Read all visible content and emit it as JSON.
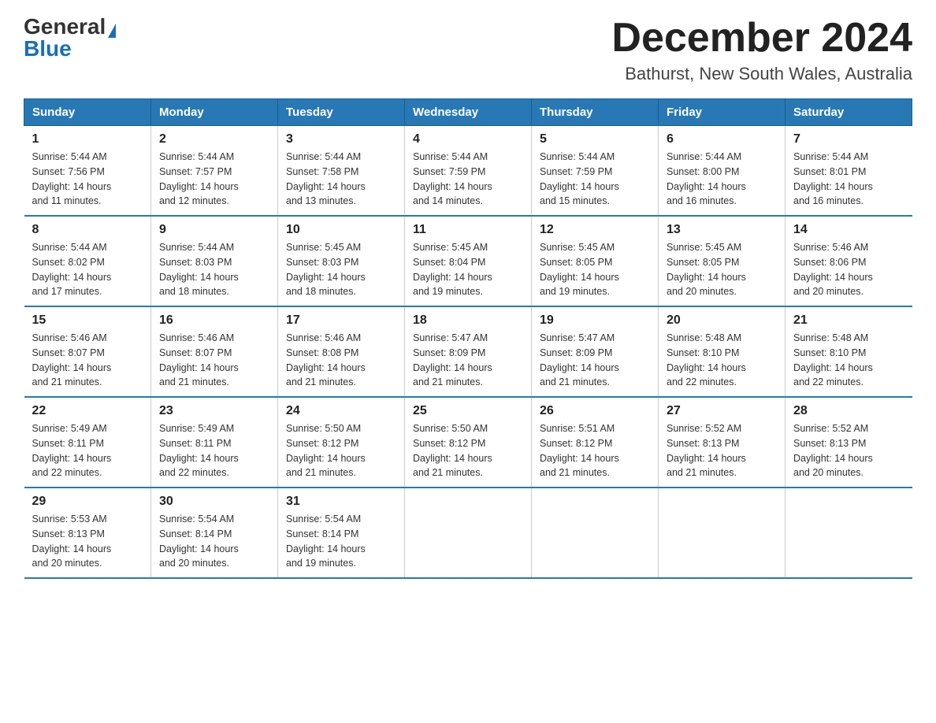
{
  "header": {
    "logo_general": "General",
    "logo_blue": "Blue",
    "title": "December 2024",
    "subtitle": "Bathurst, New South Wales, Australia"
  },
  "days_of_week": [
    "Sunday",
    "Monday",
    "Tuesday",
    "Wednesday",
    "Thursday",
    "Friday",
    "Saturday"
  ],
  "weeks": [
    [
      {
        "num": "1",
        "sunrise": "5:44 AM",
        "sunset": "7:56 PM",
        "daylight": "14 hours and 11 minutes."
      },
      {
        "num": "2",
        "sunrise": "5:44 AM",
        "sunset": "7:57 PM",
        "daylight": "14 hours and 12 minutes."
      },
      {
        "num": "3",
        "sunrise": "5:44 AM",
        "sunset": "7:58 PM",
        "daylight": "14 hours and 13 minutes."
      },
      {
        "num": "4",
        "sunrise": "5:44 AM",
        "sunset": "7:59 PM",
        "daylight": "14 hours and 14 minutes."
      },
      {
        "num": "5",
        "sunrise": "5:44 AM",
        "sunset": "7:59 PM",
        "daylight": "14 hours and 15 minutes."
      },
      {
        "num": "6",
        "sunrise": "5:44 AM",
        "sunset": "8:00 PM",
        "daylight": "14 hours and 16 minutes."
      },
      {
        "num": "7",
        "sunrise": "5:44 AM",
        "sunset": "8:01 PM",
        "daylight": "14 hours and 16 minutes."
      }
    ],
    [
      {
        "num": "8",
        "sunrise": "5:44 AM",
        "sunset": "8:02 PM",
        "daylight": "14 hours and 17 minutes."
      },
      {
        "num": "9",
        "sunrise": "5:44 AM",
        "sunset": "8:03 PM",
        "daylight": "14 hours and 18 minutes."
      },
      {
        "num": "10",
        "sunrise": "5:45 AM",
        "sunset": "8:03 PM",
        "daylight": "14 hours and 18 minutes."
      },
      {
        "num": "11",
        "sunrise": "5:45 AM",
        "sunset": "8:04 PM",
        "daylight": "14 hours and 19 minutes."
      },
      {
        "num": "12",
        "sunrise": "5:45 AM",
        "sunset": "8:05 PM",
        "daylight": "14 hours and 19 minutes."
      },
      {
        "num": "13",
        "sunrise": "5:45 AM",
        "sunset": "8:05 PM",
        "daylight": "14 hours and 20 minutes."
      },
      {
        "num": "14",
        "sunrise": "5:46 AM",
        "sunset": "8:06 PM",
        "daylight": "14 hours and 20 minutes."
      }
    ],
    [
      {
        "num": "15",
        "sunrise": "5:46 AM",
        "sunset": "8:07 PM",
        "daylight": "14 hours and 21 minutes."
      },
      {
        "num": "16",
        "sunrise": "5:46 AM",
        "sunset": "8:07 PM",
        "daylight": "14 hours and 21 minutes."
      },
      {
        "num": "17",
        "sunrise": "5:46 AM",
        "sunset": "8:08 PM",
        "daylight": "14 hours and 21 minutes."
      },
      {
        "num": "18",
        "sunrise": "5:47 AM",
        "sunset": "8:09 PM",
        "daylight": "14 hours and 21 minutes."
      },
      {
        "num": "19",
        "sunrise": "5:47 AM",
        "sunset": "8:09 PM",
        "daylight": "14 hours and 21 minutes."
      },
      {
        "num": "20",
        "sunrise": "5:48 AM",
        "sunset": "8:10 PM",
        "daylight": "14 hours and 22 minutes."
      },
      {
        "num": "21",
        "sunrise": "5:48 AM",
        "sunset": "8:10 PM",
        "daylight": "14 hours and 22 minutes."
      }
    ],
    [
      {
        "num": "22",
        "sunrise": "5:49 AM",
        "sunset": "8:11 PM",
        "daylight": "14 hours and 22 minutes."
      },
      {
        "num": "23",
        "sunrise": "5:49 AM",
        "sunset": "8:11 PM",
        "daylight": "14 hours and 22 minutes."
      },
      {
        "num": "24",
        "sunrise": "5:50 AM",
        "sunset": "8:12 PM",
        "daylight": "14 hours and 21 minutes."
      },
      {
        "num": "25",
        "sunrise": "5:50 AM",
        "sunset": "8:12 PM",
        "daylight": "14 hours and 21 minutes."
      },
      {
        "num": "26",
        "sunrise": "5:51 AM",
        "sunset": "8:12 PM",
        "daylight": "14 hours and 21 minutes."
      },
      {
        "num": "27",
        "sunrise": "5:52 AM",
        "sunset": "8:13 PM",
        "daylight": "14 hours and 21 minutes."
      },
      {
        "num": "28",
        "sunrise": "5:52 AM",
        "sunset": "8:13 PM",
        "daylight": "14 hours and 20 minutes."
      }
    ],
    [
      {
        "num": "29",
        "sunrise": "5:53 AM",
        "sunset": "8:13 PM",
        "daylight": "14 hours and 20 minutes."
      },
      {
        "num": "30",
        "sunrise": "5:54 AM",
        "sunset": "8:14 PM",
        "daylight": "14 hours and 20 minutes."
      },
      {
        "num": "31",
        "sunrise": "5:54 AM",
        "sunset": "8:14 PM",
        "daylight": "14 hours and 19 minutes."
      },
      null,
      null,
      null,
      null
    ]
  ],
  "labels": {
    "sunrise": "Sunrise:",
    "sunset": "Sunset:",
    "daylight": "Daylight:"
  }
}
